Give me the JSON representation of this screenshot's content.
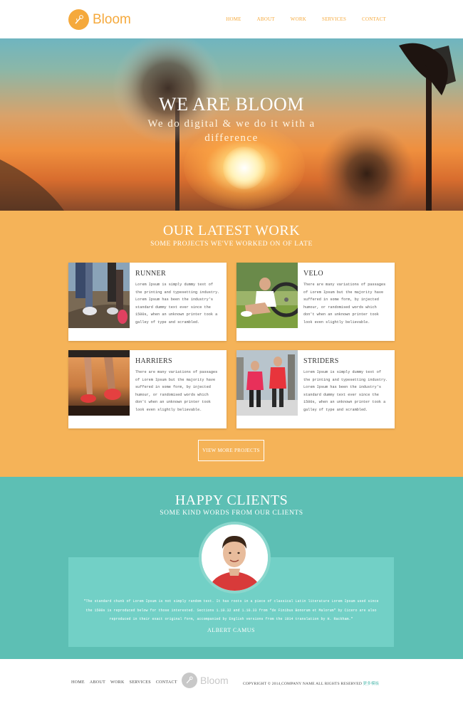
{
  "header": {
    "logo_text": "Bloom",
    "nav": [
      "HOME",
      "ABOUT",
      "WORK",
      "SERVICES",
      "CONTACT"
    ]
  },
  "hero": {
    "title": "WE ARE BLOOM",
    "subtitle": "We do digital & we do it with a difference"
  },
  "work": {
    "title": "OUR LATEST WORK",
    "subtitle": "SOME PROJECTS WE'VE WORKED ON OF LATE",
    "cards": [
      {
        "title": "RUNNER",
        "text": "Lorem Ipsum is simply dummy text of the printing and typesetting industry. Lorem Ipsum has been the industry's standard dummy text ever since the 1500s, when an unknown printer took a galley of type and scrambled."
      },
      {
        "title": "VELO",
        "text": "There are many variations of passages of Lorem Ipsum but the majority have suffered in some form, by injected humour, or randomised words which don't when an unknown printer took look even slightly believable."
      },
      {
        "title": "HARRIERS",
        "text": "There are many variations of passages of Lorem Ipsum but the majority have suffered in some form, by injected humour, or randomised words which don't when an unknown printer took look even slightly believable."
      },
      {
        "title": "STRIDERS",
        "text": "Lorem Ipsum is simply dummy text of the printing and typesetting industry. Lorem Ipsum has been the industry's standard dummy text ever since the 1500s, when an unknown printer took a galley of type and scrambled."
      }
    ],
    "more_button": "VIEW MORE PROJECTS"
  },
  "clients": {
    "title": "HAPPY CLIENTS",
    "subtitle": "SOME KIND WORDS FROM OUR CLIENTS",
    "quote": "\"The standard chunk of Lorem Ipsum is not simply random text. It has roots in a piece of classical Latin literature Lorem Ipsum used since the 1500s is reproduced below for those interested. Sections 1.10.32 and 1.10.33 from \"de Finibus Bonorum et Malorum\" by Cicero are also reproduced in their exact original form, accompanied by English versions from the 1914 translation by H. Rackham.\"",
    "author": "ALBERT CAMUS"
  },
  "footer": {
    "nav": [
      "HOME",
      "ABOUT",
      "WORK",
      "SERVICES",
      "CONTACT"
    ],
    "logo_text": "Bloom",
    "copyright": "COPYRIGHT © 2014,COMPANY NAME ALL RIGHTS RESERVED",
    "copyright_link": "更多模板"
  },
  "colors": {
    "orange": "#f5b358",
    "teal": "#5dbfb4",
    "accent": "#f5a93c"
  }
}
